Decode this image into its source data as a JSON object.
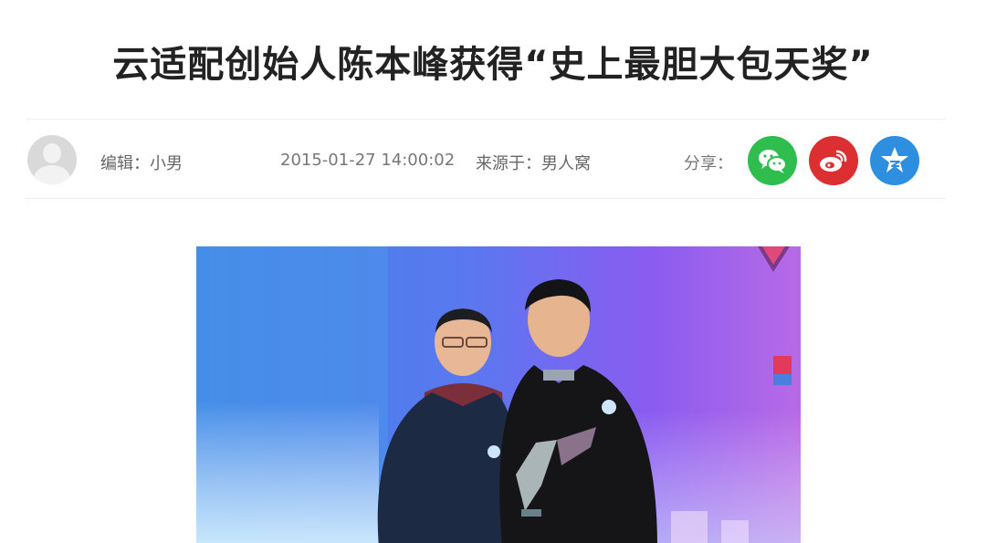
{
  "article": {
    "title": "云适配创始人陈本峰获得“史上最胆大包天奖”"
  },
  "meta": {
    "editor": "编辑：小男",
    "datetime": "2015-01-27 14:00:02",
    "source": "来源于：男人窝",
    "share_label": "分享："
  },
  "share_buttons": [
    {
      "icon": "wechat-icon",
      "color": "#2fbd4e"
    },
    {
      "icon": "weibo-icon",
      "color": "#dc2f32"
    },
    {
      "icon": "qzone-icon",
      "color": "#2e8fe0"
    }
  ],
  "photo": {
    "background_colors": [
      "#3a8fe8",
      "#7b5cf0",
      "#c07ae8"
    ]
  }
}
